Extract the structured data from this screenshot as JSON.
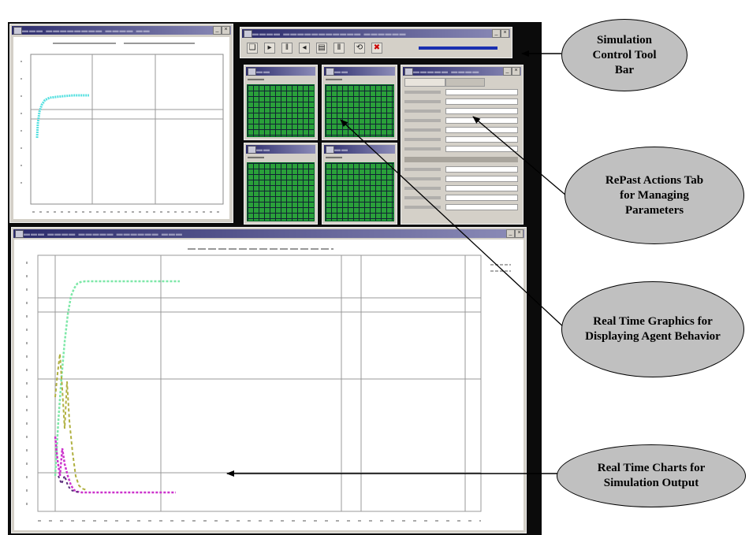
{
  "callouts": {
    "toolbar": "Simulation Control Tool Bar",
    "actions_tab": "RePast Actions Tab for Managing Parameters",
    "graphics": "Real Time Graphics for Displaying Agent Behavior",
    "charts": "Real Time Charts for Simulation Output"
  },
  "colors": {
    "callout_fill": "#c0c0c0",
    "agent_grid": "#2aa03a",
    "series_top": "#7ee8a8",
    "series_cyan": "#55e0e0",
    "series_bottom": "#cc33cc",
    "series_mid": "#b0b040"
  },
  "icons": [
    "step-icon",
    "start-icon",
    "pause-icon",
    "stop-icon",
    "setup-icon",
    "initialize-icon",
    "view-settings-icon",
    "exit-icon"
  ]
}
